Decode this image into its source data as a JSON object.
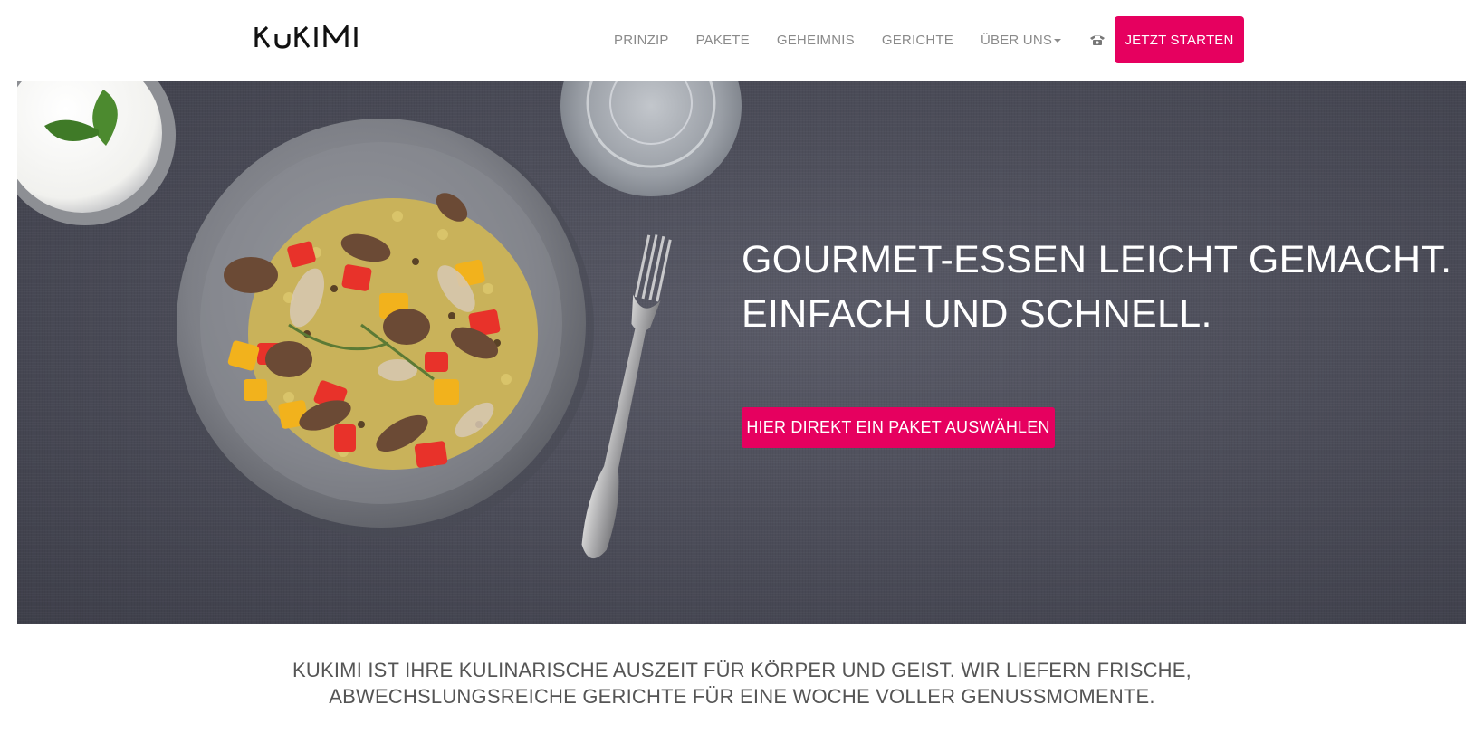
{
  "brand": {
    "logo_text": "KUKIMI",
    "accent_color": "#e6005f"
  },
  "nav": {
    "items": [
      {
        "label": "PRINZIP"
      },
      {
        "label": "PAKETE"
      },
      {
        "label": "GEHEIMNIS"
      },
      {
        "label": "GERICHTE"
      },
      {
        "label": "ÜBER UNS"
      }
    ],
    "phone_icon": "phone-icon",
    "cta_label": "JETZT STARTEN"
  },
  "hero": {
    "title_line1": "GOURMET-ESSEN LEICHT GEMACHT.",
    "title_line2": "EINFACH UND SCHNELL.",
    "cta_label": "HIER DIREKT EIN PAKET AUSWÄHLEN"
  },
  "intro": {
    "line1": "KUKIMI IST IHRE KULINARISCHE AUSZEIT FÜR KÖRPER UND GEIST. WIR LIEFERN FRISCHE,",
    "line2": "ABWECHSLUNGSREICHE GERICHTE FÜR EINE WOCHE VOLLER GENUSSMOMENTE."
  }
}
